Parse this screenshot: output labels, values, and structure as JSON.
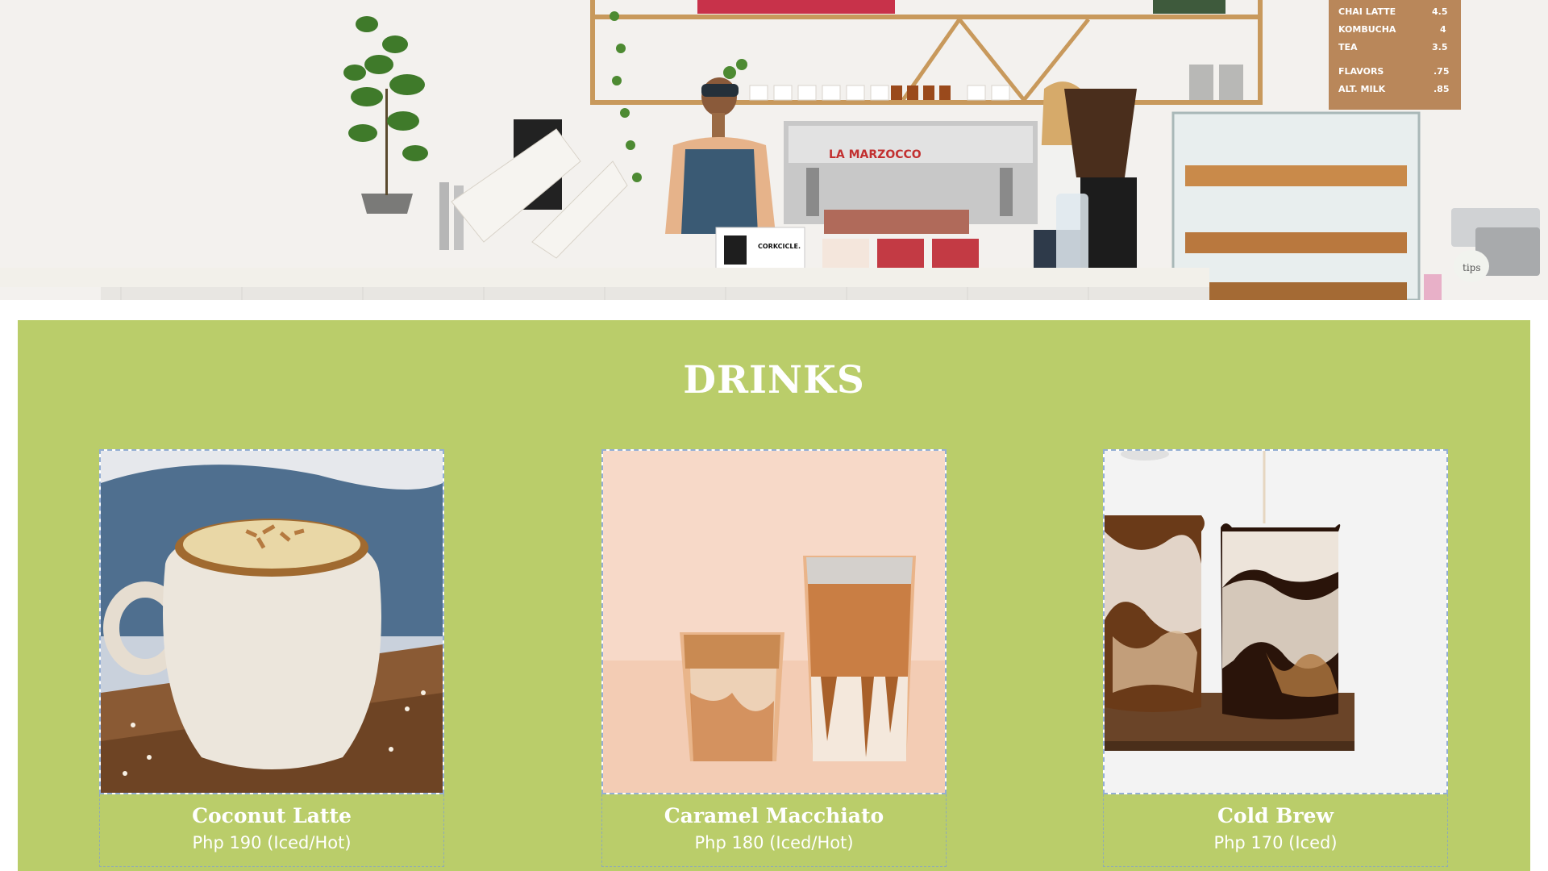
{
  "hero": {
    "menu_board": [
      {
        "item": "CHAI LATTE",
        "price": "4.5"
      },
      {
        "item": "KOMBUCHA",
        "price": "4"
      },
      {
        "item": "TEA",
        "price": "3.5"
      },
      {
        "item": "FLAVORS",
        "price": ".75"
      },
      {
        "item": "ALT. MILK",
        "price": ".85"
      }
    ],
    "machine_brand": "LA MARZOCCO",
    "cup_brand": "CORKCICLE.",
    "tips_label": "tips"
  },
  "drinks": {
    "title": "DRINKS",
    "items": [
      {
        "name": "Coconut Latte",
        "price": "Php 190 (Iced/Hot)"
      },
      {
        "name": "Caramel Macchiato",
        "price": "Php 180 (Iced/Hot)"
      },
      {
        "name": "Cold Brew",
        "price": "Php 170 (Iced)"
      }
    ]
  },
  "colors": {
    "section_bg": "#bacd6a",
    "text": "#ffffff",
    "card_border": "#82a0cd"
  }
}
